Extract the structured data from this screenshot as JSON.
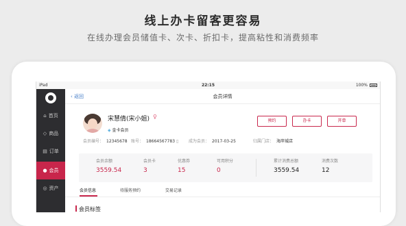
{
  "promo": {
    "title": "线上办卡留客更容易",
    "subtitle": "在线办理会员储值卡、次卡、折扣卡，提高粘性和消费频率"
  },
  "statusbar": {
    "device": "iPad",
    "time": "22:15",
    "battery": "100%"
  },
  "sidebar": {
    "items": [
      {
        "label": "首页",
        "icon": "home-icon",
        "glyph": "⌂"
      },
      {
        "label": "商品",
        "icon": "tag-icon",
        "glyph": "◇"
      },
      {
        "label": "订单",
        "icon": "order-icon",
        "glyph": "▤"
      },
      {
        "label": "会员",
        "icon": "member-icon",
        "glyph": "●"
      },
      {
        "label": "资产",
        "icon": "asset-icon",
        "glyph": "◎"
      }
    ],
    "active_index": 3
  },
  "navbar": {
    "back_label": "返回",
    "title": "会员详情"
  },
  "member": {
    "name": "宋慧倩(宋小姐)",
    "gender_icon": "♀",
    "level": "金卡会员",
    "level_icon": "◈",
    "number_label": "会员编号：",
    "number": "12345678",
    "account_label": "账号：",
    "account": "18664567783",
    "account_icon": "▯",
    "joined_label": "成为会员：",
    "joined": "2017-03-25",
    "store_label": "归属门店：",
    "store": "海岸城店"
  },
  "actions": {
    "appointment": "预约",
    "card": "办卡",
    "order": "开单"
  },
  "stats": [
    {
      "label": "会员余额",
      "value": "3559.54",
      "tone": "red"
    },
    {
      "label": "会员卡",
      "value": "3",
      "tone": "red"
    },
    {
      "label": "优惠券",
      "value": "15",
      "tone": "red"
    },
    {
      "label": "可用积分",
      "value": "0",
      "tone": "red"
    },
    {
      "label": "累计消费总额",
      "value": "3559.54",
      "tone": "dark"
    },
    {
      "label": "消费次数",
      "value": "12",
      "tone": "dark"
    }
  ],
  "tabs": [
    "会员信息",
    "待服务预约",
    "交易记录"
  ],
  "section": {
    "title": "会员标签"
  },
  "colors": {
    "accent": "#c8264b",
    "sidebar": "#2d2d30",
    "link": "#4a80c8"
  }
}
